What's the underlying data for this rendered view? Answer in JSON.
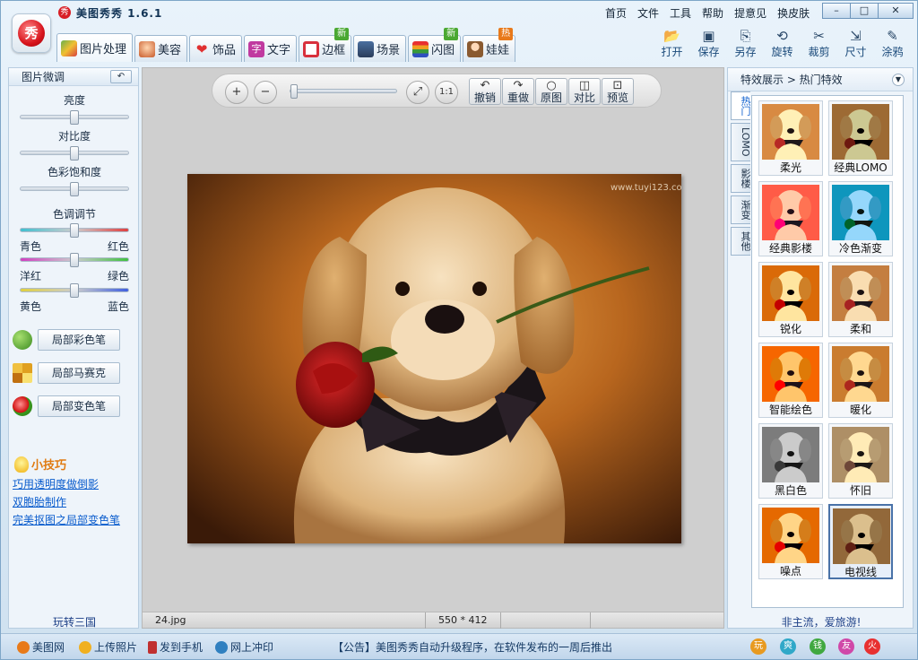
{
  "app": {
    "title": "美图秀秀 1.6.1",
    "logo_char": "秀",
    "menu": [
      "首页",
      "文件",
      "工具",
      "帮助",
      "提意见",
      "换皮肤"
    ]
  },
  "window_controls": {
    "min": "–",
    "max": "□",
    "close": "✕"
  },
  "tabs": [
    {
      "label": "图片处理",
      "badge": ""
    },
    {
      "label": "美容",
      "badge": ""
    },
    {
      "label": "饰品",
      "badge": ""
    },
    {
      "label": "文字",
      "badge": ""
    },
    {
      "label": "边框",
      "badge": "新"
    },
    {
      "label": "场景",
      "badge": ""
    },
    {
      "label": "闪图",
      "badge": "新"
    },
    {
      "label": "娃娃",
      "badge": "热"
    }
  ],
  "toolbar": {
    "open": "打开",
    "save": "保存",
    "save_as": "另存",
    "rotate": "旋转",
    "crop": "裁剪",
    "resize": "尺寸",
    "doodle": "涂鸦"
  },
  "left_panel": {
    "header": "图片微调",
    "reset_icon": "↶",
    "sliders": {
      "brightness": {
        "label": "亮度",
        "value": 0.5
      },
      "contrast": {
        "label": "对比度",
        "value": 0.5
      },
      "saturation": {
        "label": "色彩饱和度",
        "value": 0.5
      }
    },
    "color_tone": {
      "label": "色调调节",
      "cyan": "青色",
      "red": "红色",
      "magenta": "洋红",
      "green": "绿色",
      "yellow": "黄色",
      "blue": "蓝色",
      "cr_value": 0.5,
      "mg_value": 0.5,
      "yb_value": 0.5
    },
    "tools": {
      "color_pen": "局部彩色笔",
      "mosaic": "局部马赛克",
      "change_color": "局部变色笔"
    },
    "tips": {
      "title": "小技巧",
      "links": [
        "巧用透明度做倒影",
        "双胞胎制作",
        "完美抠图之局部变色笔"
      ]
    },
    "footer": "玩转三国"
  },
  "canvas": {
    "view_controls": {
      "zoom_in": "+",
      "zoom_out": "−",
      "fit": "⤢",
      "actual": "1:1",
      "zoom_value": 0.0
    },
    "edit": {
      "undo": "撤销",
      "redo": "重做",
      "original": "原图",
      "compare": "对比",
      "preview": "预览"
    },
    "watermark": "www.tuyi123.com",
    "status": {
      "filename": "24.jpg",
      "dimensions": "550 * 412"
    }
  },
  "right_panel": {
    "header": "特效展示 > 热门特效",
    "vtabs": [
      "热门",
      "LOMO",
      "影楼",
      "渐变",
      "其他"
    ],
    "effects": [
      {
        "name": "柔光"
      },
      {
        "name": "经典LOMO"
      },
      {
        "name": "经典影楼"
      },
      {
        "name": "冷色渐变"
      },
      {
        "name": "锐化"
      },
      {
        "name": "柔和"
      },
      {
        "name": "智能绘色"
      },
      {
        "name": "暖化"
      },
      {
        "name": "黑白色"
      },
      {
        "name": "怀旧"
      },
      {
        "name": "噪点"
      },
      {
        "name": "电视线"
      }
    ],
    "selected_effect": "电视线",
    "footer": "非主流，爱旅游!"
  },
  "bottom_bar": {
    "meitu_net": "美图网",
    "upload": "上传照片",
    "send_phone": "发到手机",
    "print_online": "网上冲印",
    "notice": "【公告】美图秀秀自动升级程序，在软件发布的一周后推出",
    "circles": [
      "玩",
      "爽",
      "钱",
      "友",
      "火"
    ]
  }
}
